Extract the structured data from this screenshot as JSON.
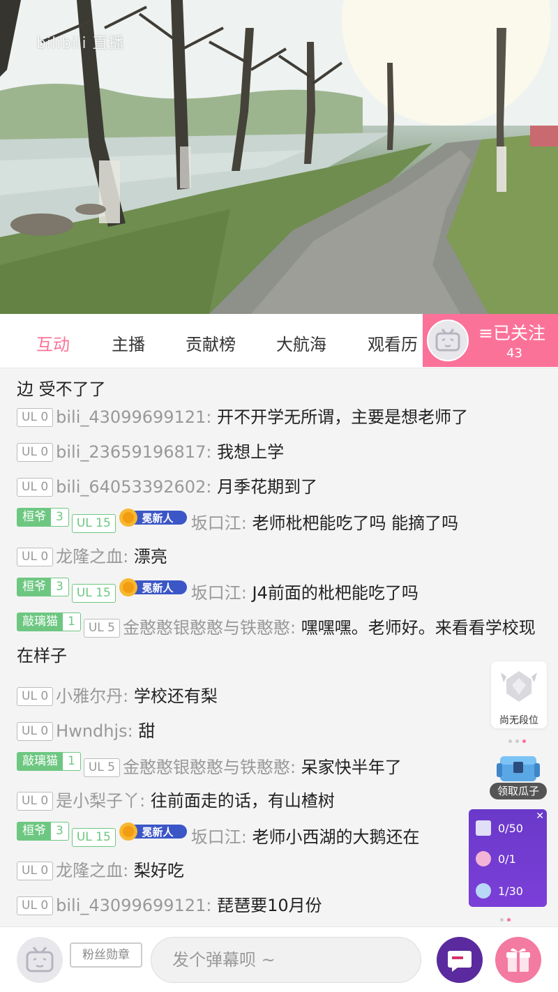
{
  "video": {
    "logo": "bilibili 直播"
  },
  "tabs": [
    "互动",
    "主播",
    "贡献榜",
    "大航海",
    "观看历"
  ],
  "follow": {
    "label": "≡已关注",
    "count": "43"
  },
  "messages": [
    {
      "medal": "",
      "medal_level": "",
      "ul": "UL 0",
      "ul_green": false,
      "title": false,
      "user": "bili_43099699121:",
      "text": "开不开学无所谓，主要是想老师了"
    },
    {
      "medal": "",
      "medal_level": "",
      "ul": "UL 0",
      "ul_green": false,
      "title": false,
      "user": "bili_23659196817:",
      "text": "我想上学"
    },
    {
      "medal": "",
      "medal_level": "",
      "ul": "UL 0",
      "ul_green": false,
      "title": false,
      "user": "bili_64053392602:",
      "text": "月季花期到了"
    },
    {
      "medal": "桓爷",
      "medal_level": "3",
      "ul": "UL 15",
      "ul_green": true,
      "title": true,
      "user": "坂口江:",
      "text": "老师枇杷能吃了吗 能摘了吗"
    },
    {
      "medal": "",
      "medal_level": "",
      "ul": "UL 0",
      "ul_green": false,
      "title": false,
      "user": "龙隆之血:",
      "text": "漂亮"
    },
    {
      "medal": "桓爷",
      "medal_level": "3",
      "ul": "UL 15",
      "ul_green": true,
      "title": true,
      "user": "坂口江:",
      "text": "J4前面的枇杷能吃了吗"
    },
    {
      "medal": "敲璃猫",
      "medal_level": "1",
      "ul": "UL 5",
      "ul_green": false,
      "title": false,
      "user": "金憨憨银憨憨与铁憨憨:",
      "text": "嘿嘿嘿。老师好。来看看学校现在样子"
    },
    {
      "medal": "",
      "medal_level": "",
      "ul": "UL 0",
      "ul_green": false,
      "title": false,
      "user": "小雅尔丹:",
      "text": "学校还有梨"
    },
    {
      "medal": "",
      "medal_level": "",
      "ul": "UL 0",
      "ul_green": false,
      "title": false,
      "user": "Hwndhjs:",
      "text": "甜"
    },
    {
      "medal": "敲璃猫",
      "medal_level": "1",
      "ul": "UL 5",
      "ul_green": false,
      "title": false,
      "user": "金憨憨银憨憨与铁憨憨:",
      "text": "呆家快半年了"
    },
    {
      "medal": "",
      "medal_level": "",
      "ul": "UL 0",
      "ul_green": false,
      "title": false,
      "user": "是小梨子丫:",
      "text": "往前面走的话，有山楂树"
    },
    {
      "medal": "桓爷",
      "medal_level": "3",
      "ul": "UL 15",
      "ul_green": true,
      "title": true,
      "user": "坂口江:",
      "text": "老师小西湖的大鹅还在"
    },
    {
      "medal": "",
      "medal_level": "",
      "ul": "UL 0",
      "ul_green": false,
      "title": false,
      "user": "龙隆之血:",
      "text": "梨好吃"
    },
    {
      "medal": "",
      "medal_level": "",
      "ul": "UL 0",
      "ul_green": false,
      "title": false,
      "user": "bili_43099699121:",
      "text": "琵琶要10月份"
    }
  ],
  "partial_message": {
    "text": "边 受不了了"
  },
  "title_badge_text": "冕新人",
  "rank": {
    "label": "尚无段位"
  },
  "chest": {
    "label": "领取瓜子"
  },
  "tasks": [
    {
      "value": "0/50"
    },
    {
      "value": "0/1"
    },
    {
      "value": "1/30"
    }
  ],
  "bottom": {
    "fans_medal": "粉丝勋章",
    "input_placeholder": "发个弹幕呗 ~"
  },
  "colors": {
    "accent": "#fb7299",
    "medal_green": "#6dc781",
    "task_purple": "#6a39c9"
  },
  "icons": [
    "tv-avatar-icon",
    "rank-badge-icon",
    "treasure-chest-icon",
    "danmaku-skin-icon",
    "gift-icon"
  ]
}
